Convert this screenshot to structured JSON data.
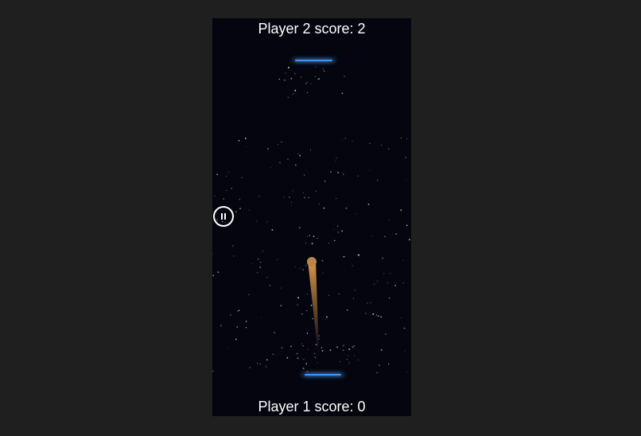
{
  "game": {
    "player2_score_text": "Player 2 score: 2",
    "player1_score_text": "Player 1 score: 0",
    "player2_score": 2,
    "player1_score": 0
  },
  "colors": {
    "page_background": "#1f1f1f",
    "field_background": "#04050f",
    "paddle_glow": "#3c95ff",
    "ball": "#b8864a",
    "ball_trail": "#c98d45",
    "score_text": "#ffffff"
  },
  "icons": {
    "pause": "pause-icon"
  }
}
